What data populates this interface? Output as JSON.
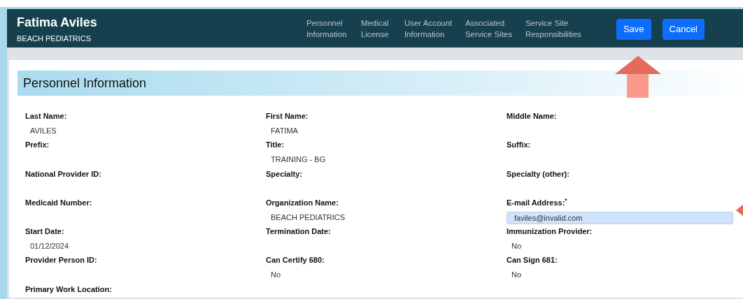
{
  "header": {
    "name": "Fatima Aviles",
    "organization": "BEACH PEDIATRICS"
  },
  "nav": [
    {
      "label": "Personnel Information"
    },
    {
      "label": "Medical License"
    },
    {
      "label": "User Account Information"
    },
    {
      "label": "Associated Service Sites"
    },
    {
      "label": "Service Site Responsibilities"
    }
  ],
  "buttons": [
    {
      "label": "Save"
    },
    {
      "label": "Cancel"
    }
  ],
  "section": {
    "title": "Personnel Information"
  },
  "fields": [
    {
      "label": "Last Name:",
      "value": "AVILES",
      "kind": "text"
    },
    {
      "label": "First Name:",
      "value": "FATIMA",
      "kind": "text"
    },
    {
      "label": "Middle Name:"
    },
    {
      "label": "Prefix:"
    },
    {
      "label": "Title:",
      "value": "TRAINING - BG",
      "kind": "text"
    },
    {
      "label": "Suffix:"
    },
    {
      "label": "National Provider ID:"
    },
    {
      "label": "Specialty:"
    },
    {
      "label": "Specialty (other):"
    },
    {
      "label": "Medicaid Number:"
    },
    {
      "label": "Organization Name:",
      "value": "BEACH PEDIATRICS",
      "kind": "text"
    },
    {
      "label": "E-mail Address:$^{*}$",
      "value": "faviles@invalid.com",
      "kind": "input"
    },
    {
      "label": "Start Date:",
      "value": "01/12/2024",
      "kind": "text"
    },
    {
      "label": "Termination Date:"
    },
    {
      "label": "Immunization Provider:",
      "value": "No",
      "kind": "text"
    },
    {
      "label": "Provider Person ID:"
    },
    {
      "label": "Can Certify 680:",
      "value": "No",
      "kind": "text"
    },
    {
      "label": "Can Sign 681:",
      "value": "No",
      "kind": "text"
    },
    {
      "label": "Primary Work Location:"
    }
  ]
}
